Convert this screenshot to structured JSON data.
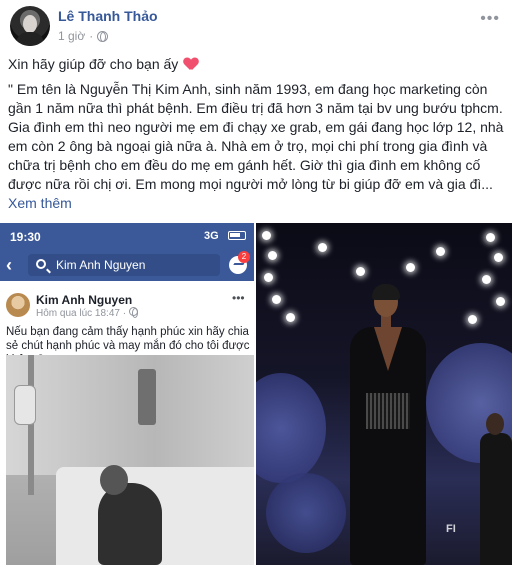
{
  "post": {
    "author": "Lê Thanh Thảo",
    "time": "1 giờ",
    "caption": "Xin hãy giúp đỡ cho bạn ấy",
    "body": "\" Em tên là Nguyễn Thị Kim Anh, sinh năm 1993, em đang học marketing còn gần 1 năm nữa thì phát bệnh. Em điều trị đã hơn 3 năm tại bv ung bướu tphcm. Gia đình em thì neo người mẹ em đi chạy xe grab, em gái đang học lớp 12, nhà em còn 2 ông bà ngoại già nữa à. Nhà em ở trọ, mọi chi phí trong gia đình và chữa trị bệnh cho em đều do mẹ em gánh hết. Giờ thì gia đình em không cố được nữa rồi chị ơi. Em mong mọi người mở lòng từ bi giúp đỡ em và gia đì...",
    "see_more": "Xem thêm"
  },
  "screenshot": {
    "time": "19:30",
    "network": "3G",
    "search_value": "Kim Anh Nguyen",
    "badge": "2",
    "inner_author": "Kim Anh Nguyen",
    "inner_time": "Hôm qua lúc 18:47 · ",
    "inner_text": "Nếu bạn đang cảm thấy hạnh phúc xin hãy chia sẻ chút hạnh phúc và may mắn đó cho tôi được không?"
  },
  "runway": {
    "stage_text": "FI"
  },
  "colors": {
    "facebook_blue": "#3b5998",
    "link_blue": "#365899",
    "heart": "#f0506e"
  }
}
